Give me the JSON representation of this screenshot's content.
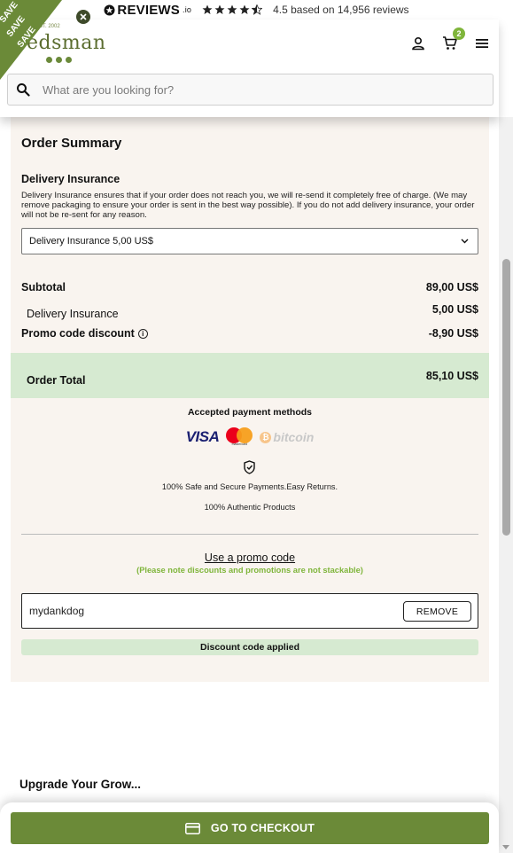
{
  "reviews_bar": {
    "brand": "REVIEWS",
    "brand_suffix": ".io",
    "rating_text": "4.5 based on 14,956 reviews",
    "stars_full": 4,
    "stars_half": 1
  },
  "header": {
    "logo_text": "edsman",
    "logo_tag": "EST. 2002",
    "cart_count": "2",
    "search_placeholder": "What are you looking for?"
  },
  "ribbon": {
    "words": [
      "SAVE",
      "SAVE",
      "SAVE"
    ]
  },
  "order_summary": {
    "title": "Order Summary",
    "delivery_insurance": {
      "title": "Delivery Insurance",
      "description": "Delivery Insurance ensures that if your order does not reach you, we will re-send it completely free of charge. (We may remove packaging to ensure your order is sent in the best way possible). If you do not add delivery insurance, your order will not be re-sent for any reason.",
      "selected_option": "Delivery Insurance 5,00 US$"
    },
    "subtotal_label": "Subtotal",
    "subtotal_value": "89,00 US$",
    "insurance_label": "Delivery Insurance",
    "insurance_value": "5,00 US$",
    "promo_discount_label": "Promo code discount",
    "promo_discount_value": "-8,90 US$",
    "total_label": "Order Total",
    "total_value": "85,10 US$",
    "payment": {
      "title": "Accepted payment methods",
      "visa": "VISA",
      "mastercard": "mastercard",
      "bitcoin": "bitcoin",
      "secure_text": "100% Safe and Secure Payments.Easy Returns.",
      "authentic_text": "100% Authentic Products"
    },
    "promo": {
      "link_text": "Use a promo code",
      "note": "(Please note discounts and promotions are not stackable)",
      "code_value": "mydankdog",
      "remove_label": "REMOVE",
      "applied_text": "Discount code applied"
    }
  },
  "upgrade_title": "Upgrade Your Grow...",
  "checkout": {
    "label": "GO TO CHECKOUT"
  },
  "colors": {
    "brand_green": "#6b8a38",
    "accent_green": "#7fb53b",
    "panel_bg": "#f9f4ef",
    "total_bg": "#d6ead1"
  }
}
